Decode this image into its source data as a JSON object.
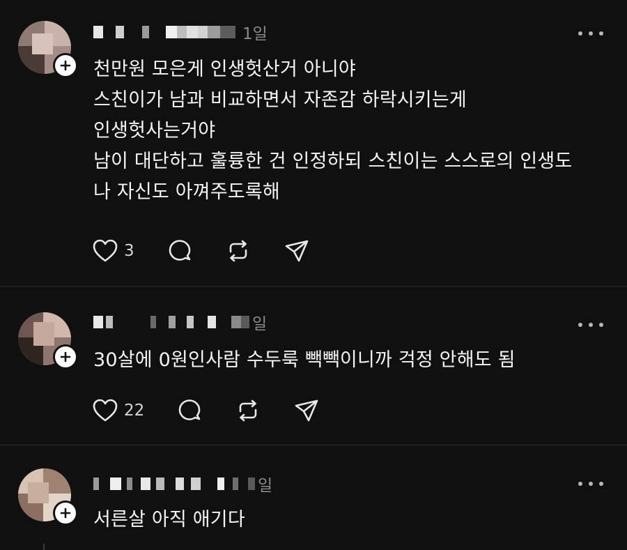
{
  "posts": [
    {
      "time": "1일",
      "lines": [
        "천만원 모은게 인생헛산거 아니야",
        "스친이가 남과 비교하면서 자존감 하락시키는게",
        "인생헛사는거야",
        "남이 대단하고 훌륭한 건 인정하되 스친이는 스스로의 인생도",
        "나 자신도 아껴주도록해"
      ],
      "like_count": "3",
      "icons": [
        "avatar",
        "plus-icon",
        "more-icon",
        "heart-icon",
        "comment-icon",
        "repost-icon",
        "share-icon"
      ]
    },
    {
      "time": "일",
      "lines": [
        "30살에 0원인사람 수두룩 빽빽이니까 걱정 안해도 됨"
      ],
      "like_count": "22",
      "icons": [
        "avatar",
        "plus-icon",
        "more-icon",
        "heart-icon",
        "comment-icon",
        "repost-icon",
        "share-icon"
      ]
    },
    {
      "time": "일",
      "lines": [
        "서른살 아직 애기다"
      ],
      "like_count": "",
      "icons": [
        "avatar",
        "plus-icon",
        "more-icon"
      ]
    }
  ],
  "colors": {
    "background": "#101010",
    "text": "#f5f5f5",
    "muted": "#8a8a8a",
    "divider": "#2e2e2e"
  }
}
